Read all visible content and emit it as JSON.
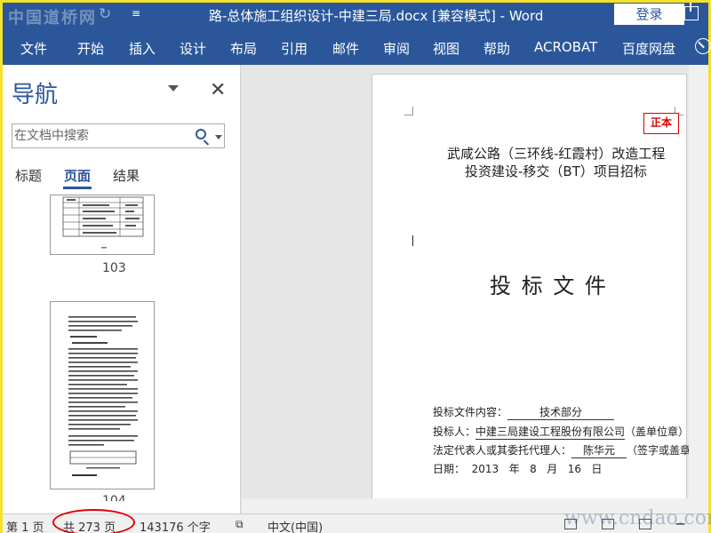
{
  "titlebar": {
    "logo_text": "中国道桥网",
    "doc_title": "路-总体施工组织设计-中建三局.docx [兼容模式]  -  Word",
    "login_label": "登录"
  },
  "ribbon": {
    "tabs": [
      "文件",
      "开始",
      "插入",
      "设计",
      "布局",
      "引用",
      "邮件",
      "审阅",
      "视图",
      "帮助",
      "ACROBAT",
      "百度网盘"
    ]
  },
  "nav_pane": {
    "title": "导航",
    "search_placeholder": "在文档中搜索",
    "tabs": [
      "标题",
      "页面",
      "结果"
    ],
    "active_tab": "页面",
    "thumbnails": [
      {
        "page_label": "103"
      },
      {
        "page_label": "104"
      }
    ]
  },
  "document": {
    "badge": "正本",
    "title_line1": "武咸公路（三环线-红霞村）改造工程",
    "title_line2": "投资建设-移交（BT）项目招标",
    "main_heading": "投 标 文 件",
    "content_label": "投标文件内容：",
    "content_value": "技术部分",
    "bidder_label": "投标人：",
    "bidder_value": "中建三局建设工程股份有限公司",
    "bidder_note": "（盖单位章）",
    "rep_label": "法定代表人或其委托代理人：",
    "rep_value": "陈华元",
    "rep_note": "（签字或盖章）",
    "date_label": "日期：",
    "date_year": "2013",
    "date_y": "年",
    "date_month": "8",
    "date_m": "月",
    "date_day": "16",
    "date_d": "日"
  },
  "statusbar": {
    "page": "第 1 页",
    "total_pages": "共 273 页",
    "word_count": "143176 个字",
    "language": "中文(中国)"
  },
  "watermark": "www.cndao.com",
  "colors": {
    "accent": "#2b579a",
    "highlight_circle": "#dd0000",
    "frame": "#f5e12a"
  }
}
